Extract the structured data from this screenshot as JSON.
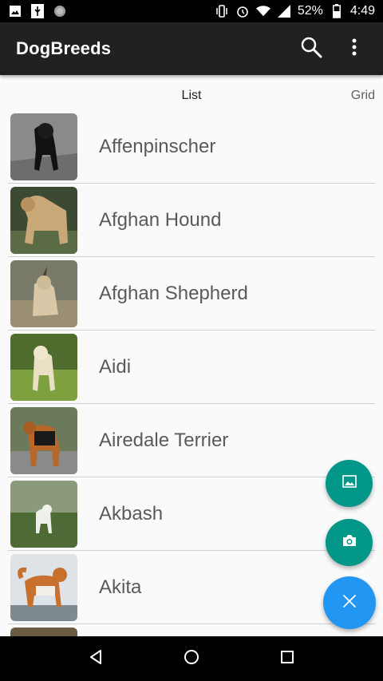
{
  "status_bar": {
    "battery_percent": "52%",
    "time": "4:49",
    "left_icons": [
      "image-icon",
      "usb-icon",
      "circle-icon"
    ],
    "right_icons": [
      "vibrate-icon",
      "alarm-icon",
      "wifi-icon",
      "signal-icon",
      "battery-icon"
    ]
  },
  "app_bar": {
    "title": "DogBreeds",
    "actions": [
      "search-icon",
      "more-vert-icon"
    ]
  },
  "tabs": {
    "list_label": "List",
    "grid_label": "Grid"
  },
  "breeds": [
    {
      "name": "Affenpinscher"
    },
    {
      "name": "Afghan Hound"
    },
    {
      "name": "Afghan Shepherd"
    },
    {
      "name": "Aidi"
    },
    {
      "name": "Airedale Terrier"
    },
    {
      "name": "Akbash"
    },
    {
      "name": "Akita"
    }
  ],
  "fabs": {
    "gallery_icon": "image-icon",
    "camera_icon": "camera-icon",
    "close_icon": "close-icon"
  },
  "colors": {
    "app_bar": "#212121",
    "fab_teal": "#009688",
    "fab_blue": "#2196f3"
  }
}
